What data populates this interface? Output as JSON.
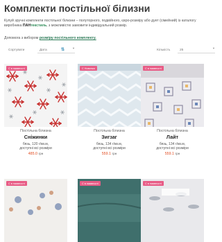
{
  "page": {
    "title": "Комплекти постільної білизни",
    "description": "Купуй зручні комплекти постільної білизни – полуторного, подвійного, євро-розміру або дует (сімейний) із каталогу виробника ",
    "brand_pan": "ПАН",
    "brand_tex": "текстиль",
    "description_tail": ", з можливістю замовити індивідуальний розмір.",
    "help_prefix": "Допомога з вибором ",
    "help_link": "розміру постільного комплекту."
  },
  "filters": {
    "sort_label": "Сортувати",
    "sort_value": "Дата",
    "count_label": "Кількість",
    "count_value": "25"
  },
  "products": [
    {
      "badge": "С в наявності",
      "subtitle": "Постільна білизна",
      "title": "Сніжинки",
      "specs1": "бязь, 120 г/кв.м,",
      "specs2": "доступні всі розміри",
      "price": "485.0",
      "currency": "грн"
    },
    {
      "badge": "С Новинка",
      "subtitle": "Постільна білизна",
      "title": "Зигзаг",
      "specs1": "бязь, 134 г/кв.м,",
      "specs2": "доступні всі розміри",
      "price": "559.1",
      "currency": "грн"
    },
    {
      "badge": "С в наявності",
      "subtitle": "Постільна білизна",
      "title": "Лайт",
      "specs1": "бязь, 134 г/кв.м,",
      "specs2": "доступні всі розміри",
      "price": "559.1",
      "currency": "грн"
    },
    {
      "badge": "С в наявності"
    },
    {
      "badge": "С в наявності"
    },
    {
      "badge": "С в наявності"
    }
  ],
  "colors": {
    "badge": "#e85c86",
    "price": "#e14b1f",
    "link": "#2b7a56",
    "brand_tex": "#2e8b57"
  }
}
